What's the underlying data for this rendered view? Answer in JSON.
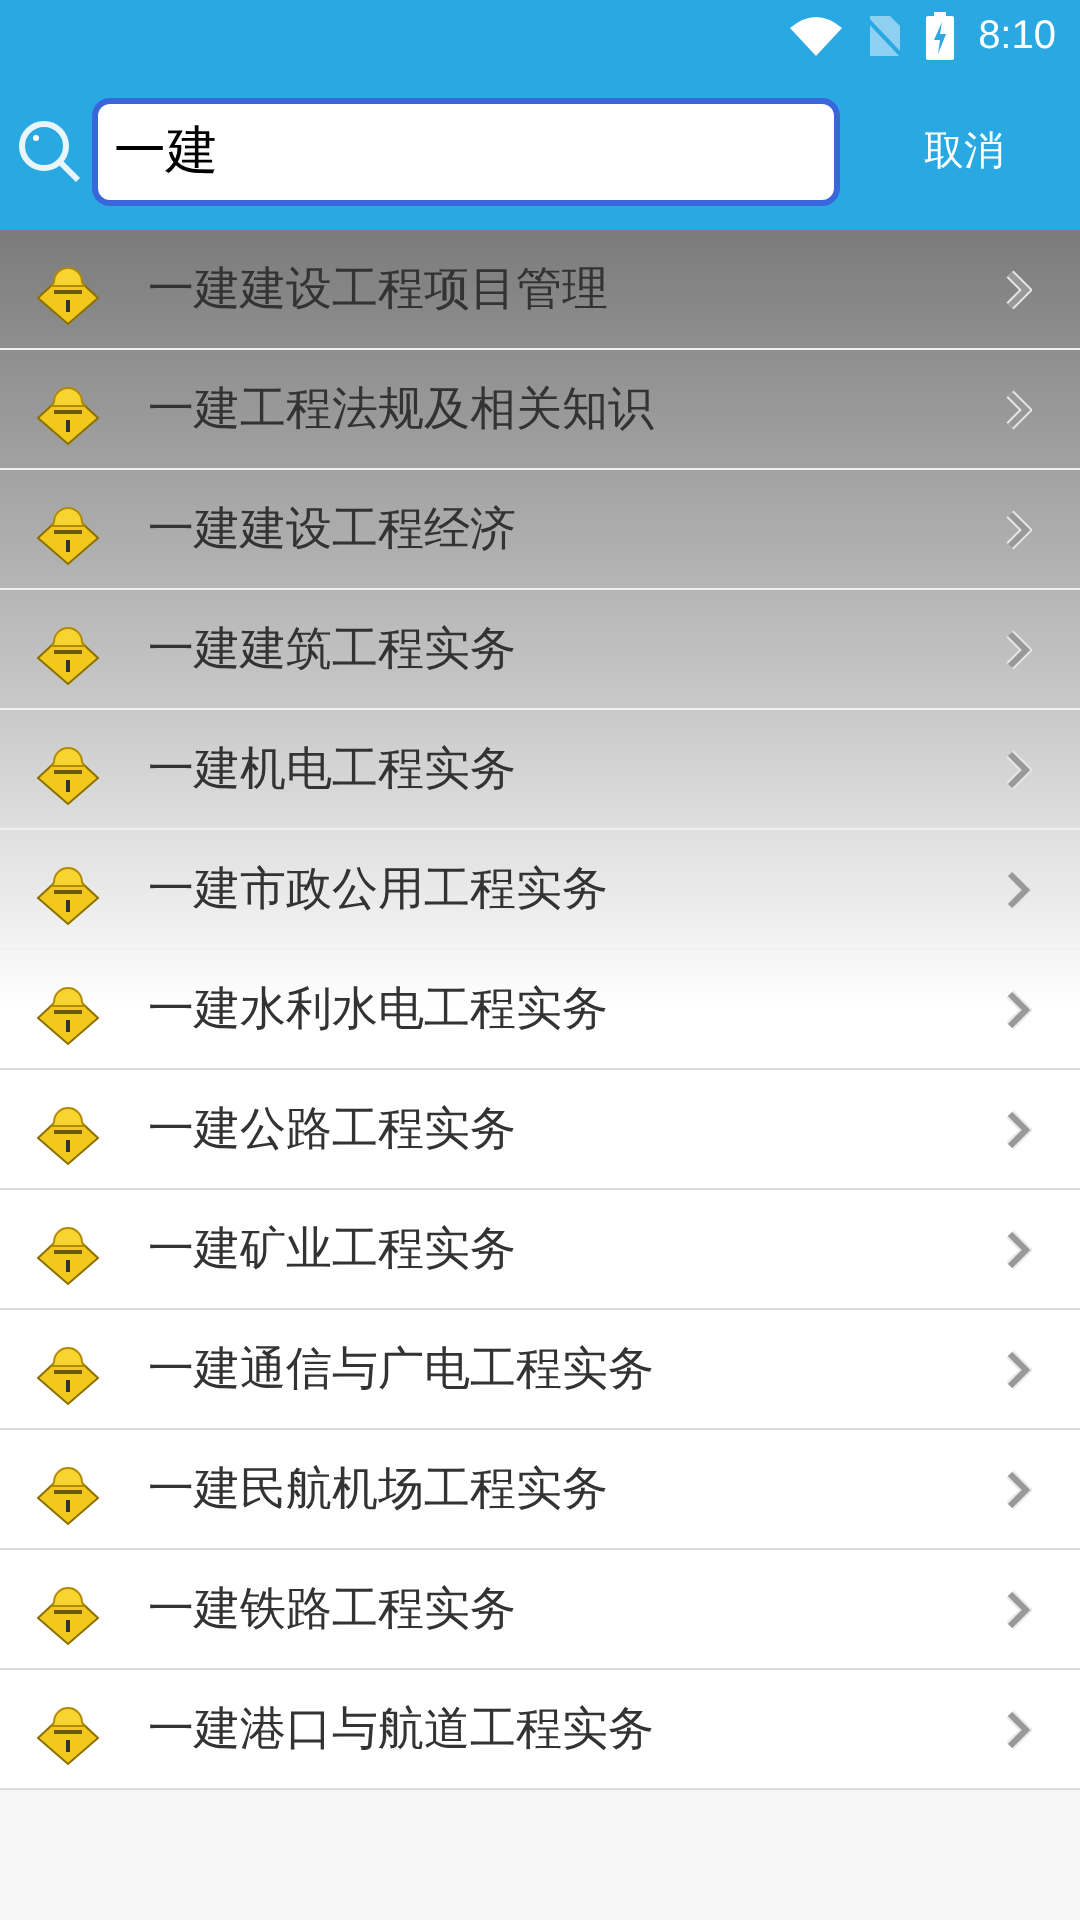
{
  "status_bar": {
    "time": "8:10"
  },
  "search": {
    "value": "一建",
    "cancel": "取消"
  },
  "results": [
    {
      "title": "一建建设工程项目管理"
    },
    {
      "title": "一建工程法规及相关知识"
    },
    {
      "title": "一建建设工程经济"
    },
    {
      "title": "一建建筑工程实务"
    },
    {
      "title": "一建机电工程实务"
    },
    {
      "title": "一建市政公用工程实务"
    },
    {
      "title": "一建水利水电工程实务"
    },
    {
      "title": "一建公路工程实务"
    },
    {
      "title": "一建矿业工程实务"
    },
    {
      "title": "一建通信与广电工程实务"
    },
    {
      "title": "一建民航机场工程实务"
    },
    {
      "title": "一建铁路工程实务"
    },
    {
      "title": "一建港口与航道工程实务"
    }
  ]
}
